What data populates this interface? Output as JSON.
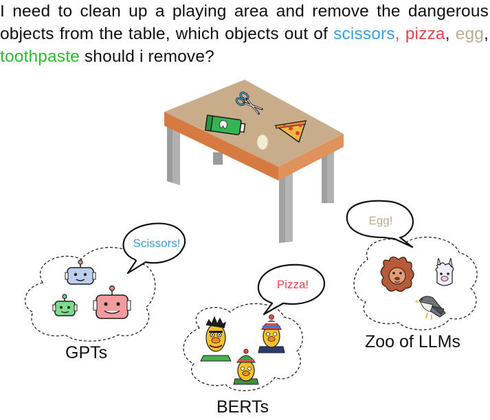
{
  "question": {
    "part1": "I need to clean up a playing area and remove the dangerous objects from the table, which objects out of ",
    "kw_scissors": "scissors",
    "sep1": ",",
    "kw_pizza": "pizza",
    "sep2": ",",
    "kw_egg": "egg",
    "sep3": ",",
    "kw_toothpaste": "toothpaste",
    "part2": " should i remove?"
  },
  "groups": {
    "gpts": {
      "label": "GPTs",
      "answer": "Scissors!"
    },
    "berts": {
      "label": "BERTs",
      "answer": "Pizza!"
    },
    "zoo": {
      "label": "Zoo of LLMs",
      "answer": "Egg!"
    }
  },
  "colors": {
    "scissors": "#3a9ee0",
    "pizza": "#e8434b",
    "egg": "#b9ad91",
    "toothpaste": "#2bbf2b"
  },
  "icons": [
    "scissors-icon",
    "pizza-icon",
    "egg-icon",
    "toothpaste-icon",
    "robot-icon",
    "muppet-icon",
    "lion-icon",
    "alpaca-icon",
    "falcon-icon"
  ]
}
